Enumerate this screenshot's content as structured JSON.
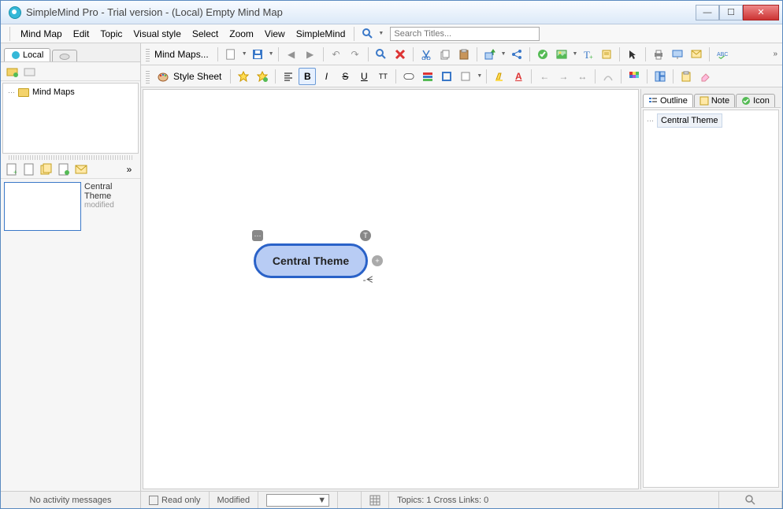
{
  "window": {
    "title": "SimpleMind Pro - Trial version - (Local) Empty Mind Map"
  },
  "menu": {
    "items": [
      "Mind Map",
      "Edit",
      "Topic",
      "Visual style",
      "Select",
      "Zoom",
      "View",
      "SimpleMind"
    ]
  },
  "search": {
    "placeholder": "Search Titles..."
  },
  "left": {
    "tab_local": "Local",
    "tree_root": "Mind Maps",
    "thumb_label1": "Central",
    "thumb_label2": "Theme",
    "thumb_modified": "modified"
  },
  "toolbar1": {
    "label": "Mind Maps..."
  },
  "toolbar2": {
    "label": "Style Sheet",
    "bold": "B",
    "italic": "I",
    "strike": "S",
    "underline": "U",
    "tt": "TT",
    "a": "A"
  },
  "canvas": {
    "central": "Central Theme"
  },
  "right": {
    "tab_outline": "Outline",
    "tab_note": "Note",
    "tab_icon": "Icon",
    "item": "Central Theme"
  },
  "status": {
    "activity": "No activity messages",
    "readonly": "Read only",
    "modified": "Modified",
    "topics": "Topics: 1  Cross Links: 0"
  }
}
